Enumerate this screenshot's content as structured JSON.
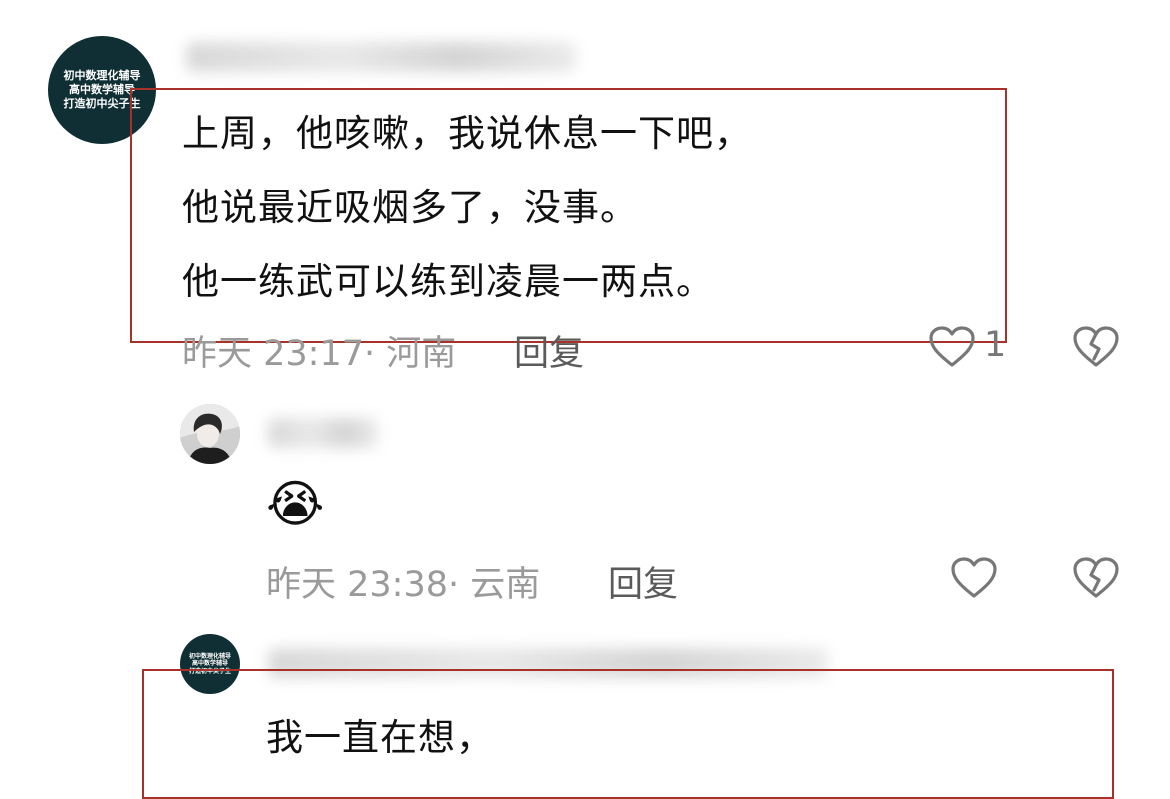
{
  "comment1": {
    "avatar_text": [
      "初中数理化辅导",
      "高中数学辅导",
      "打造初中尖子生"
    ],
    "lines": [
      "上周，他咳嗽，我说休息一下吧，",
      "他说最近吸烟多了，没事。",
      "他一练武可以练到凌晨一两点。"
    ],
    "time": "昨天 23:17",
    "location": "河南",
    "reply_label": "回复",
    "like_count": "1"
  },
  "comment2": {
    "emoji": "😭",
    "time": "昨天 23:38",
    "location": "云南",
    "reply_label": "回复"
  },
  "comment3": {
    "avatar_text": [
      "初中数理化辅导",
      "高中数学辅导",
      "打造初中尖子生"
    ],
    "lines": [
      "我一直在想，"
    ]
  },
  "colors": {
    "highlight_border": "#a8322a",
    "avatar_bg": "#0f2f35",
    "meta_text": "#9a9a9a"
  }
}
